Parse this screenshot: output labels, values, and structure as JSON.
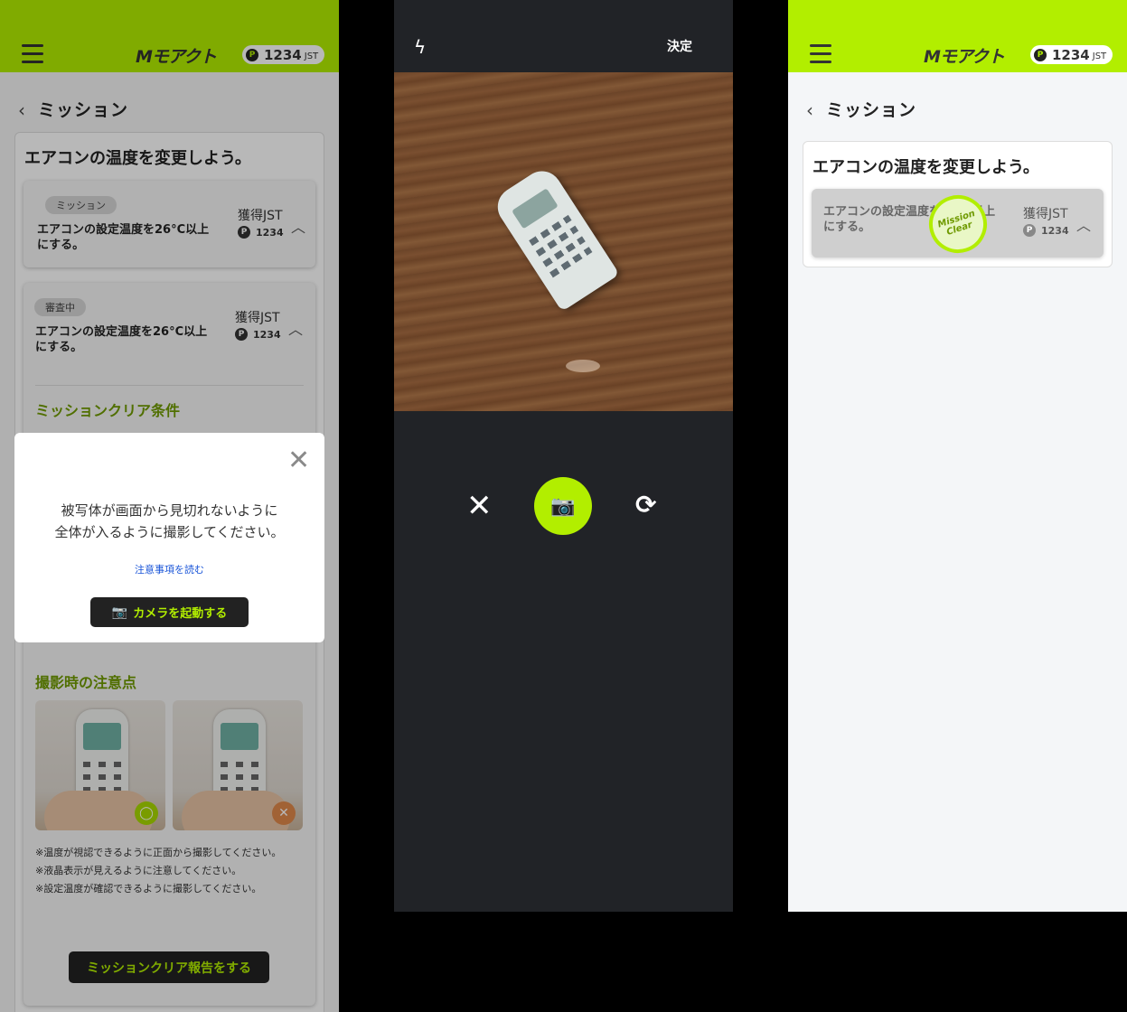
{
  "header": {
    "logo": "Mモアクト",
    "points": "1234",
    "points_unit": "JST",
    "coin": "P"
  },
  "nav": {
    "back_title": "ミッション"
  },
  "mission": {
    "title": "エアコンの温度を変更しよう。",
    "cards": [
      {
        "badge": "ミッション",
        "desc": "エアコンの設定温度を26°C以上にする。",
        "reward_label": "獲得JST",
        "reward_value": "1234"
      },
      {
        "badge": "審査中",
        "desc": "エアコンの設定温度を26°C以上にする。",
        "reward_label": "獲得JST",
        "reward_value": "1234"
      }
    ],
    "clear_conditions_heading": "ミッションクリア条件",
    "tips_heading": "撮影時の注意点",
    "notes": [
      "※温度が視認できるように正面から撮影してください。",
      "※液晶表示が見えるように注意してください。",
      "※設定温度が確認できるように撮影してください。"
    ],
    "report_button": "ミッションクリア報告をする"
  },
  "modal": {
    "close": "✕",
    "line1": "被写体が画面から見切れないように",
    "line2": "全体が入るように撮影してください。",
    "link": "注意事項を読む",
    "camera_button": "カメラを起動する"
  },
  "camera": {
    "done_button": "決定",
    "flash_icon": "flash-icon",
    "shutter_icon": "camera-icon"
  },
  "cleared": {
    "title": "エアコンの温度を変更しよう。",
    "desc": "エアコンの設定温度を26°C以上にする。",
    "reward_label": "獲得JST",
    "reward_value": "1234",
    "stamp_line1": "Mission",
    "stamp_line2": "Clear"
  },
  "colors": {
    "accent": "#b2ee00",
    "dark": "#212327",
    "link": "#1a55d8"
  }
}
